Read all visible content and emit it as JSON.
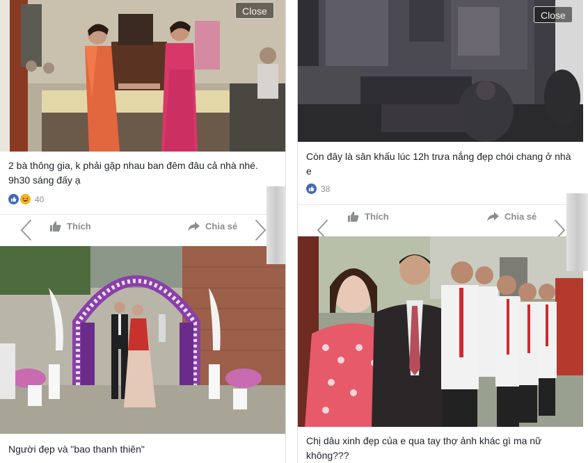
{
  "close_label": "Close",
  "left_post": {
    "caption": "2 bà thông gia, k phải gặp nhau ban đêm đâu cả nhà nhé. 9h30 sáng đấy ạ",
    "reactions": {
      "icons": [
        "like-icon",
        "haha-icon"
      ],
      "count": "40"
    },
    "actions": {
      "like": "Thích",
      "share": "Chia sẻ"
    },
    "next_caption": "Người đẹp và \"bao thanh thiên\""
  },
  "right_post": {
    "caption": "Còn đây là sân khấu lúc 12h trưa nắng đẹp chói chang ở nhà e",
    "reactions": {
      "icons": [
        "like-icon"
      ],
      "count": "38"
    },
    "actions": {
      "like": "Thích",
      "share": "Chia sẻ"
    },
    "next_caption": "Chị dâu xinh đẹp của e qua tay thợ ảnh khác gì ma nữ không???"
  },
  "colors": {
    "like_blue": "#4267b2",
    "haha_yellow": "#f7b125",
    "action_gray": "#8a8d91",
    "text_dark": "#1d2129"
  }
}
